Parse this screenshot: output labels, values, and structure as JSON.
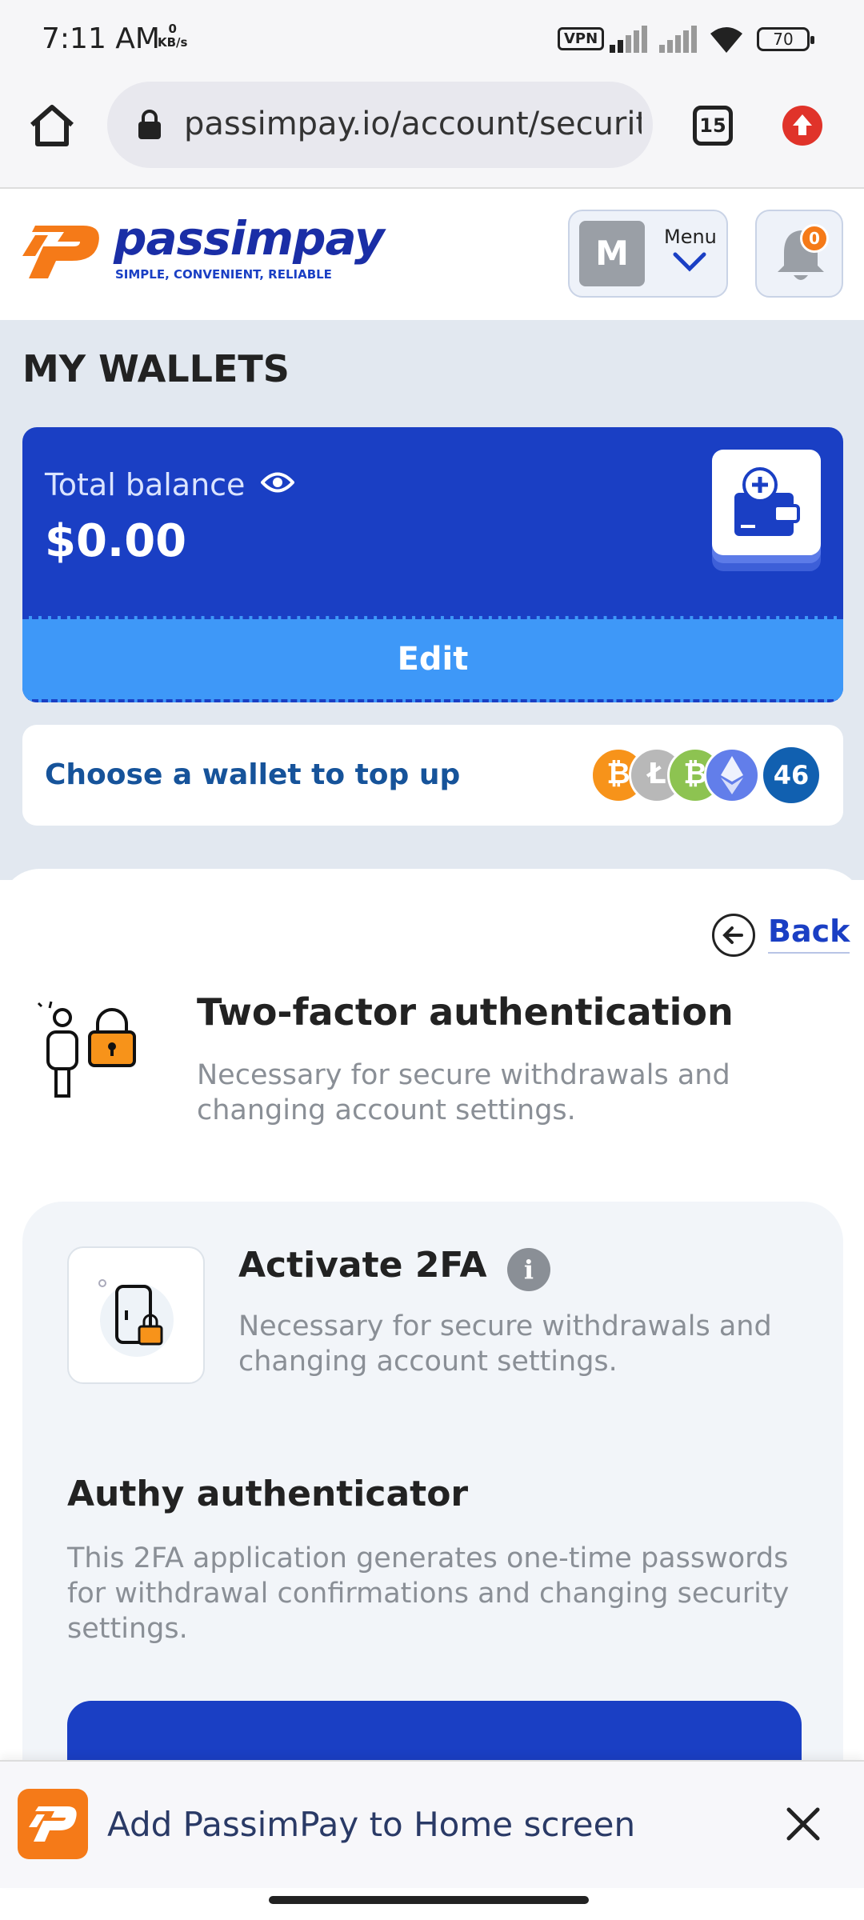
{
  "status_bar": {
    "time": "7:11 AM",
    "net_speed_value": "0",
    "net_speed_unit": "KB/s",
    "vpn_label": "VPN",
    "battery": "70"
  },
  "browser": {
    "url": "passimpay.io/account/security",
    "tab_count": "15"
  },
  "site": {
    "logo_name": "passimpay",
    "logo_tagline": "SIMPLE, CONVENIENT, RELIABLE",
    "avatar_letter": "M",
    "menu_label": "Menu",
    "notifications_count": "0"
  },
  "wallets": {
    "section_title": "MY WALLETS",
    "total_balance_label": "Total balance",
    "total_balance_value": "$0.00",
    "edit_label": "Edit",
    "topup_label": "Choose a wallet to top up",
    "coins": [
      {
        "name": "bitcoin",
        "color": "#f7931a"
      },
      {
        "name": "litecoin",
        "color": "#b8b8b8"
      },
      {
        "name": "bitcoin-cash",
        "color": "#8dc351"
      },
      {
        "name": "ethereum",
        "color": "#627eea"
      }
    ],
    "more_coins_count": "46"
  },
  "security": {
    "back_label": "Back",
    "two_factor_title": "Two-factor authentication",
    "two_factor_desc": "Necessary for secure withdrawals and changing account settings.",
    "activate_title": "Activate 2FA",
    "info_glyph": "i",
    "activate_desc": "Necessary for secure withdrawals and changing account settings.",
    "authy_title": "Authy authenticator",
    "authy_desc": "This 2FA application generates one-time passwords for withdrawal confirmations and changing security settings."
  },
  "install_banner": {
    "text": "Add PassimPay to Home screen"
  },
  "colors": {
    "brand_blue": "#1a3fc4",
    "edit_blue": "#3e98f8",
    "brand_orange": "#f57a18"
  }
}
